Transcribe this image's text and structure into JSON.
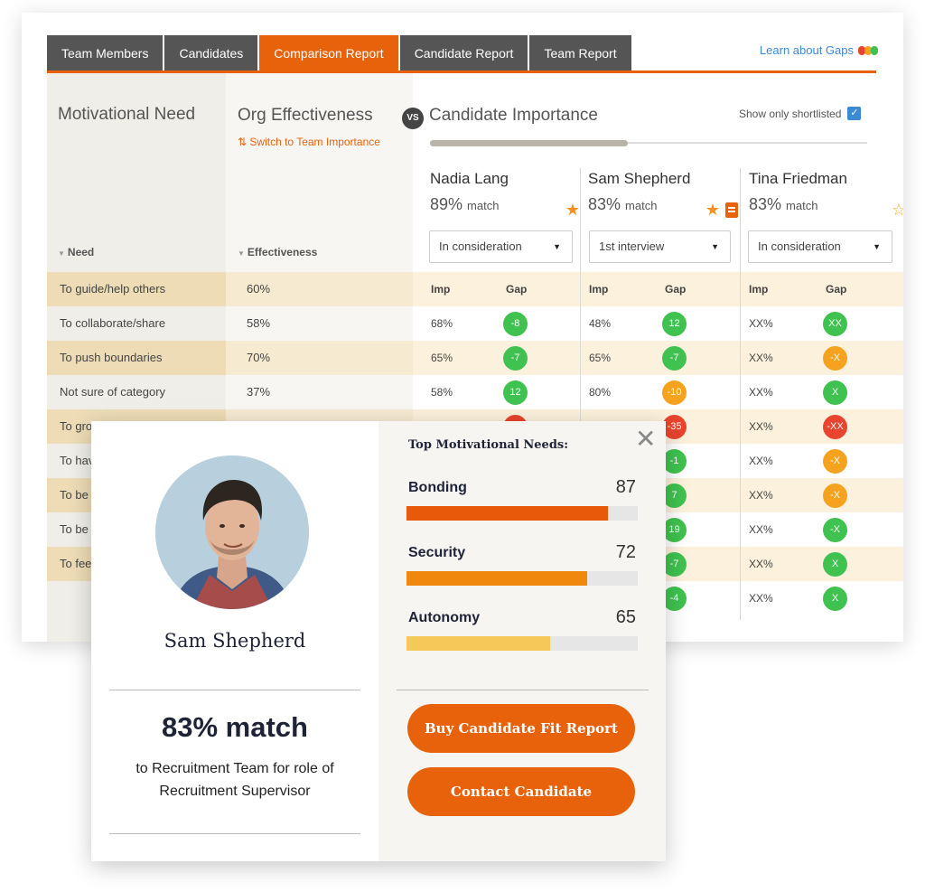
{
  "tabs": [
    {
      "label": "Team Members"
    },
    {
      "label": "Candidates"
    },
    {
      "label": "Comparison Report"
    },
    {
      "label": "Candidate Report"
    },
    {
      "label": "Team Report"
    }
  ],
  "active_tab": "Comparison Report",
  "learn_gaps": "Learn about Gaps",
  "gap_legend_colors": [
    "#e8442e",
    "#f5a21e",
    "#3fc24f"
  ],
  "headers": {
    "motivational_need": "Motivational Need",
    "org_effectiveness": "Org Effectiveness",
    "vs": "VS",
    "candidate_importance": "Candidate Importance",
    "switch_link": "Switch to Team Importance",
    "switch_icon": "swap-icon",
    "show_shortlisted": "Show only shortlisted",
    "need_col": "Need",
    "effectiveness_col": "Effectiveness",
    "imp_col": "Imp",
    "gap_col": "Gap"
  },
  "scroll_position_fraction": 0.45,
  "candidates": [
    {
      "name": "Nadia Lang",
      "match_pct": "89%",
      "match_word": "match",
      "starred": true,
      "has_report": false,
      "status": "In consideration"
    },
    {
      "name": "Sam Shepherd",
      "match_pct": "83%",
      "match_word": "match",
      "starred": true,
      "has_report": true,
      "status": "1st interview"
    },
    {
      "name": "Tina Friedman",
      "match_pct": "83%",
      "match_word": "match",
      "starred": false,
      "has_report": false,
      "status": "In consideration"
    }
  ],
  "rows": [
    {
      "need": "To guide/help others",
      "eff": "60%",
      "cells": []
    },
    {
      "need": "To collaborate/share",
      "eff": "58%",
      "cells": [
        {
          "imp": "68%",
          "gap": "-8",
          "color": "#3fc24f"
        },
        {
          "imp": "48%",
          "gap": "12",
          "color": "#3fc24f"
        },
        {
          "imp": "XX%",
          "gap": "XX",
          "color": "#3fc24f"
        }
      ]
    },
    {
      "need": "To push boundaries",
      "eff": "70%",
      "cells": [
        {
          "imp": "65%",
          "gap": "-7",
          "color": "#3fc24f"
        },
        {
          "imp": "65%",
          "gap": "-7",
          "color": "#3fc24f"
        },
        {
          "imp": "XX%",
          "gap": "-X",
          "color": "#f5a21e"
        }
      ]
    },
    {
      "need": "Not sure of category",
      "eff": "37%",
      "cells": [
        {
          "imp": "58%",
          "gap": "12",
          "color": "#3fc24f"
        },
        {
          "imp": "80%",
          "gap": "-10",
          "color": "#f5a21e"
        },
        {
          "imp": "XX%",
          "gap": "X",
          "color": "#3fc24f"
        }
      ]
    },
    {
      "need": "To gro",
      "eff": "",
      "cells": [
        {
          "imp": "",
          "gap": "",
          "color": "#e8442e"
        },
        {
          "imp": "",
          "gap": "-35",
          "color": "#e8442e"
        },
        {
          "imp": "XX%",
          "gap": "-XX",
          "color": "#e8442e"
        }
      ]
    },
    {
      "need": "To hav",
      "eff": "",
      "cells": [
        {
          "imp": "",
          "gap": "",
          "color": ""
        },
        {
          "imp": "",
          "gap": "-1",
          "color": "#3fc24f"
        },
        {
          "imp": "XX%",
          "gap": "-X",
          "color": "#f5a21e"
        }
      ]
    },
    {
      "need": "To be",
      "eff": "",
      "cells": [
        {
          "imp": "",
          "gap": "",
          "color": ""
        },
        {
          "imp": "",
          "gap": "7",
          "color": "#3fc24f"
        },
        {
          "imp": "XX%",
          "gap": "-X",
          "color": "#f5a21e"
        }
      ]
    },
    {
      "need": "To be",
      "eff": "",
      "cells": [
        {
          "imp": "",
          "gap": "",
          "color": ""
        },
        {
          "imp": "",
          "gap": "19",
          "color": "#3fc24f"
        },
        {
          "imp": "XX%",
          "gap": "-X",
          "color": "#3fc24f"
        }
      ]
    },
    {
      "need": "To fee",
      "eff": "",
      "cells": [
        {
          "imp": "",
          "gap": "",
          "color": ""
        },
        {
          "imp": "",
          "gap": "-7",
          "color": "#3fc24f"
        },
        {
          "imp": "XX%",
          "gap": "X",
          "color": "#3fc24f"
        }
      ]
    },
    {
      "need": "",
      "eff": "",
      "cells": [
        {
          "imp": "",
          "gap": "",
          "color": ""
        },
        {
          "imp": "",
          "gap": "-4",
          "color": "#3fc24f"
        },
        {
          "imp": "XX%",
          "gap": "X",
          "color": "#3fc24f"
        }
      ]
    }
  ],
  "popup": {
    "name": "Sam Shepherd",
    "match": "83% match",
    "role_text": "to Recruitment Team for role of Recruitment Supervisor",
    "top_needs_title": "Top Motivational Needs:",
    "needs": [
      {
        "label": "Bonding",
        "score": "87",
        "fraction": 0.87,
        "color": "#e85a0a"
      },
      {
        "label": "Security",
        "score": "72",
        "fraction": 0.78,
        "color": "#f0880e"
      },
      {
        "label": "Autonomy",
        "score": "65",
        "fraction": 0.62,
        "color": "#f5c85a"
      }
    ],
    "buy_button": "Buy Candidate Fit Report",
    "contact_button": "Contact Candidate",
    "close_icon": "close-icon"
  },
  "colors": {
    "accent": "#e8620c",
    "tab_dark": "#555556",
    "link_blue": "#3a8ad6"
  }
}
